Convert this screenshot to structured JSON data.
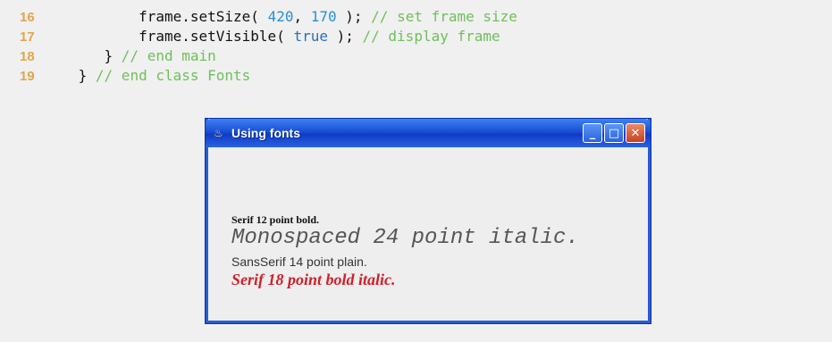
{
  "code": {
    "lines": [
      {
        "num": "16",
        "pre": "        frame.setSize( ",
        "a": "420",
        ", ": ", ",
        "b": "170",
        " ); ": " ); ",
        "comment": "// set frame size"
      },
      {
        "num": "17",
        "pre": "        frame.setVisible( ",
        "kw": "true",
        " ); ": " ); ",
        "comment": "// display frame"
      },
      {
        "num": "18",
        "pre": "    } ",
        "comment": "// end main"
      },
      {
        "num": "19",
        "pre": " } ",
        "comment": "// end class Fonts"
      }
    ]
  },
  "window": {
    "title": "Using fonts",
    "icon": "java-cup-icon",
    "controls": {
      "minimize": "_",
      "maximize": "□",
      "close": "✕"
    },
    "lines": {
      "serif12": "Serif 12 point bold.",
      "mono24": "Monospaced 24 point italic.",
      "sans14": "SansSerif 14 point plain.",
      "serif18": "Serif 18 point bold italic."
    }
  }
}
